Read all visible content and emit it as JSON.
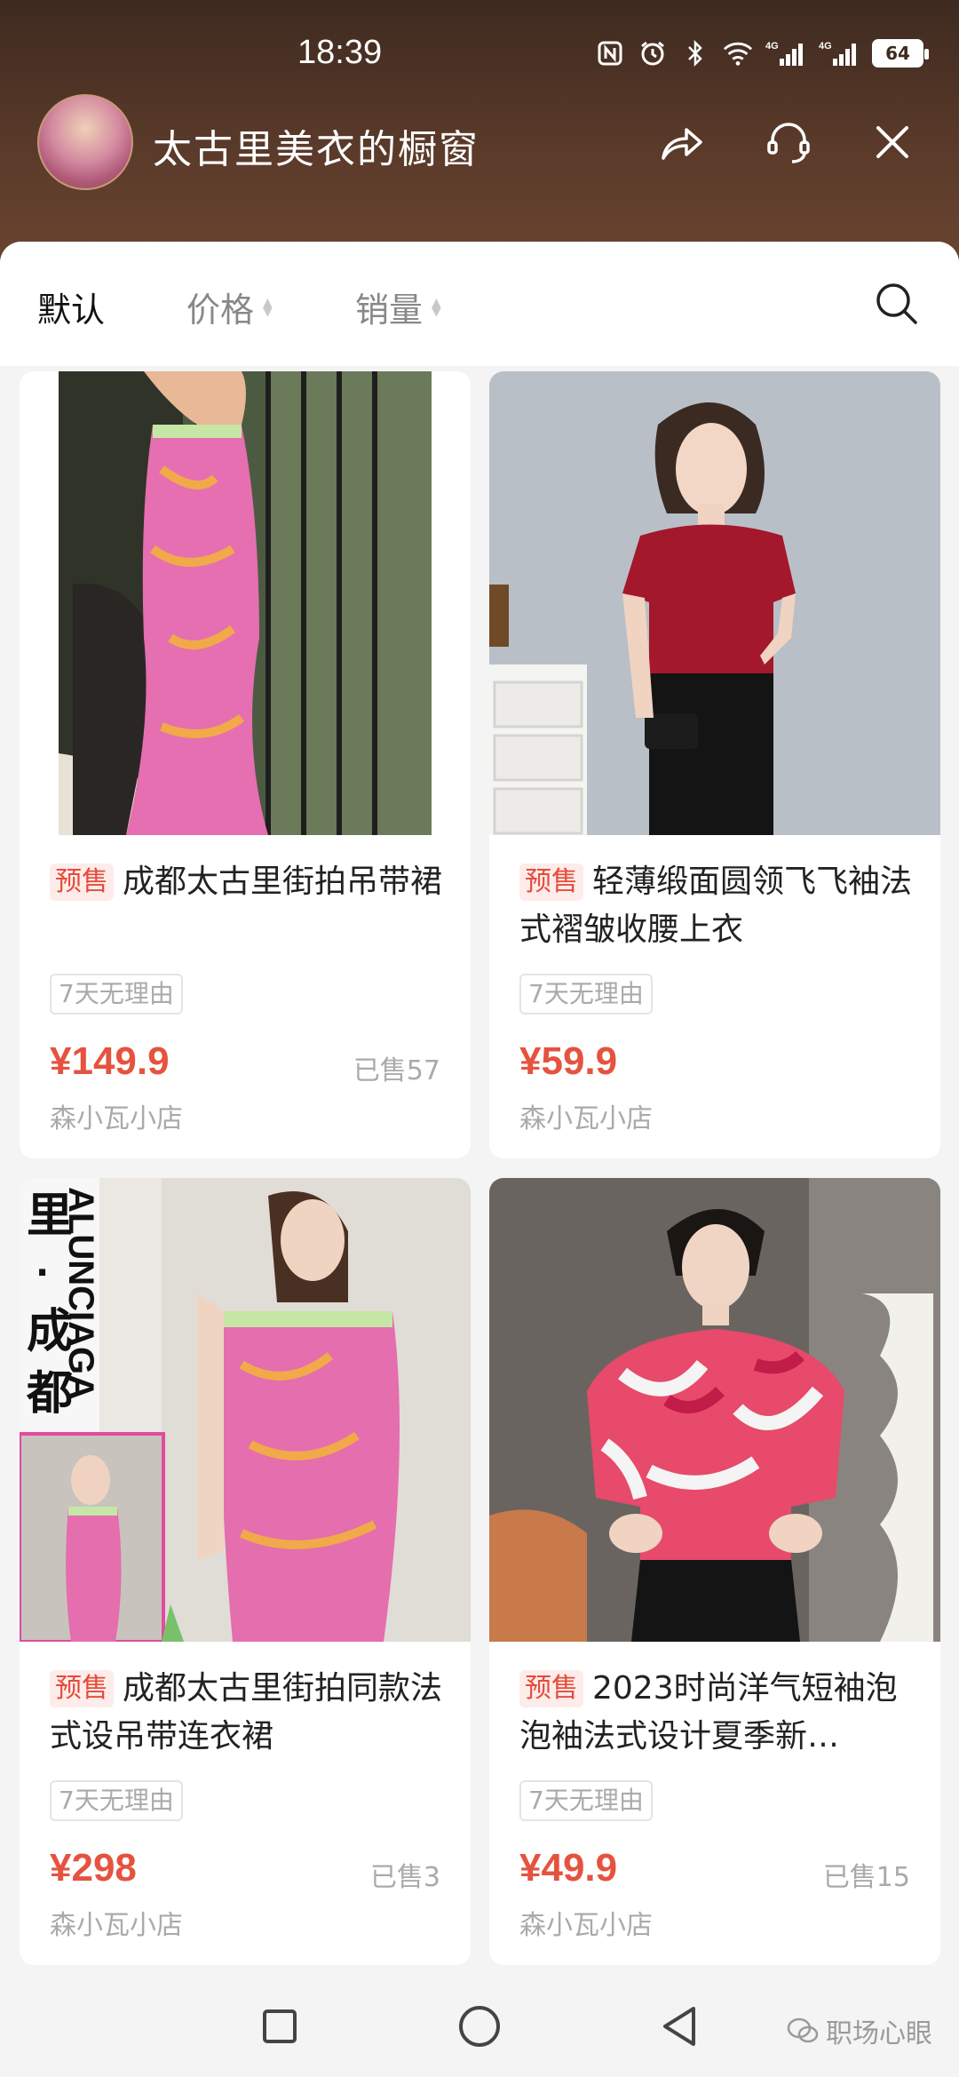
{
  "status_bar": {
    "time": "18:39",
    "network": "4G",
    "battery": "64"
  },
  "shop": {
    "title": "太古里美衣的橱窗"
  },
  "sort_bar": {
    "items": [
      {
        "label": "默认"
      },
      {
        "label": "价格"
      },
      {
        "label": "销量"
      }
    ]
  },
  "products": [
    {
      "presale": "预售",
      "title": "成都太古里街拍吊带裙",
      "return_policy": "7天无理由",
      "price": "¥149.9",
      "sold": "已售57",
      "store": "森小瓦小店"
    },
    {
      "presale": "预售",
      "title": "轻薄缎面圆领飞飞袖法式褶皱收腰上衣",
      "return_policy": "7天无理由",
      "price": "¥59.9",
      "sold": "",
      "store": "森小瓦小店"
    },
    {
      "presale": "预售",
      "title": "成都太古里街拍同款法式设吊带连衣裙",
      "return_policy": "7天无理由",
      "price": "¥298",
      "sold": "已售3",
      "store": "森小瓦小店"
    },
    {
      "presale": "预售",
      "title": "2023时尚洋气短袖泡泡袖法式设计夏季新…",
      "return_policy": "7天无理由",
      "price": "¥49.9",
      "sold": "已售15",
      "store": "森小瓦小店"
    }
  ],
  "photo_text": {
    "brand_vertical": "ALUNCIAGA",
    "city_vertical": "里·成都"
  },
  "watermark": "职场心眼",
  "colors": {
    "accent_red": "#e5533f",
    "header_brown": "#4a3226"
  }
}
